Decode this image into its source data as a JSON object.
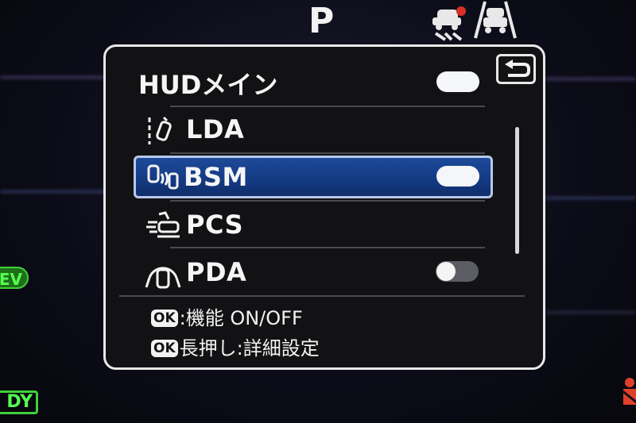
{
  "cluster": {
    "gear": "P",
    "ev_indicator": "EV",
    "ready_indicator": "READY"
  },
  "menu": {
    "back_icon": "return-arrow-icon",
    "hud_main": {
      "label": "HUDメイン",
      "toggle": "on"
    },
    "items": [
      {
        "label": "LDA",
        "icon": "lane-departure-icon",
        "toggle": null
      },
      {
        "label": "BSM",
        "icon": "blind-spot-monitor-icon",
        "toggle": "on",
        "selected": true
      },
      {
        "label": "PCS",
        "icon": "pre-collision-icon",
        "toggle": null
      },
      {
        "label": "PDA",
        "icon": "proactive-driving-icon",
        "toggle": "off"
      }
    ],
    "footer": {
      "ok_tag": "OK",
      "line1": ":機能 ON/OFF",
      "line2": "長押し:詳細設定"
    }
  },
  "colors": {
    "selection": "#1e4a9a",
    "ev_green": "#55ff50",
    "toggle_on": "#f4f6fa",
    "toggle_off": "#5c5c64",
    "warning_red": "#e0402a"
  }
}
